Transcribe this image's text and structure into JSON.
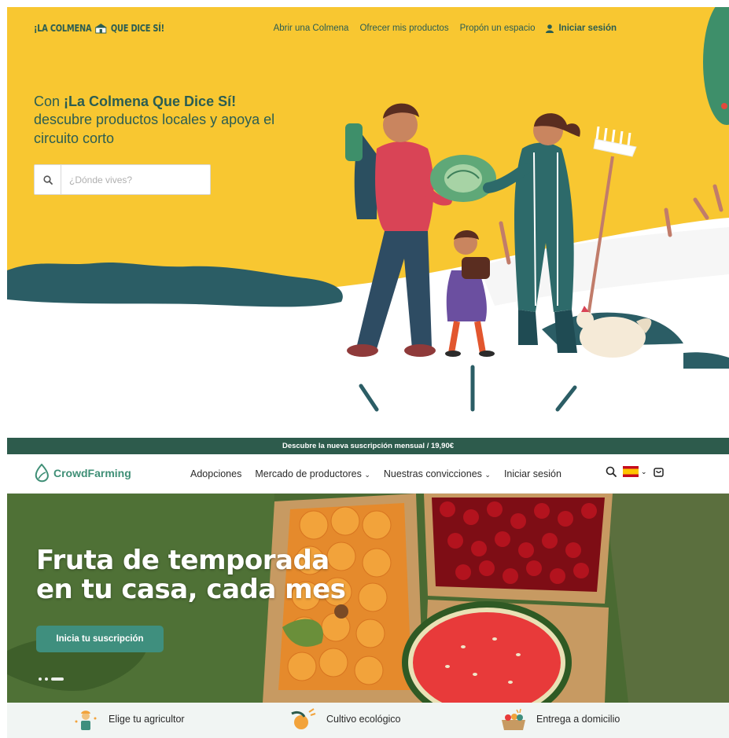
{
  "colmena": {
    "logo": {
      "left": "¡LA COLMENA",
      "right": "QUE DICE SÍ!"
    },
    "nav": {
      "items": [
        "Abrir una Colmena",
        "Ofrecer mis productos",
        "Propón un espacio"
      ],
      "login": "Iniciar sesión"
    },
    "hero": {
      "intro": "Con ",
      "brand": "¡La Colmena Que Dice Sí!",
      "tagline": "descubre productos locales y apoya el circuito corto"
    },
    "search": {
      "placeholder": "¿Dónde vives?"
    },
    "colors": {
      "background": "#f8c731",
      "text": "#2b5d52"
    }
  },
  "crowdfarming": {
    "promo": "Descubre la nueva suscripción mensual / 19,90€",
    "brand": "CrowdFarming",
    "menu": {
      "adopciones": "Adopciones",
      "mercado": "Mercado de productores",
      "convicciones": "Nuestras convicciones",
      "login": "Iniciar sesión"
    },
    "hero": {
      "title": "Fruta de temporada en tu casa, cada mes",
      "cta": "Inicia tu suscripción"
    },
    "features": [
      "Elige tu agricultor",
      "Cultivo ecológico",
      "Entrega a domicilio"
    ],
    "colors": {
      "primary": "#3f8f7e",
      "promo_bar": "#2d5b4c"
    }
  }
}
